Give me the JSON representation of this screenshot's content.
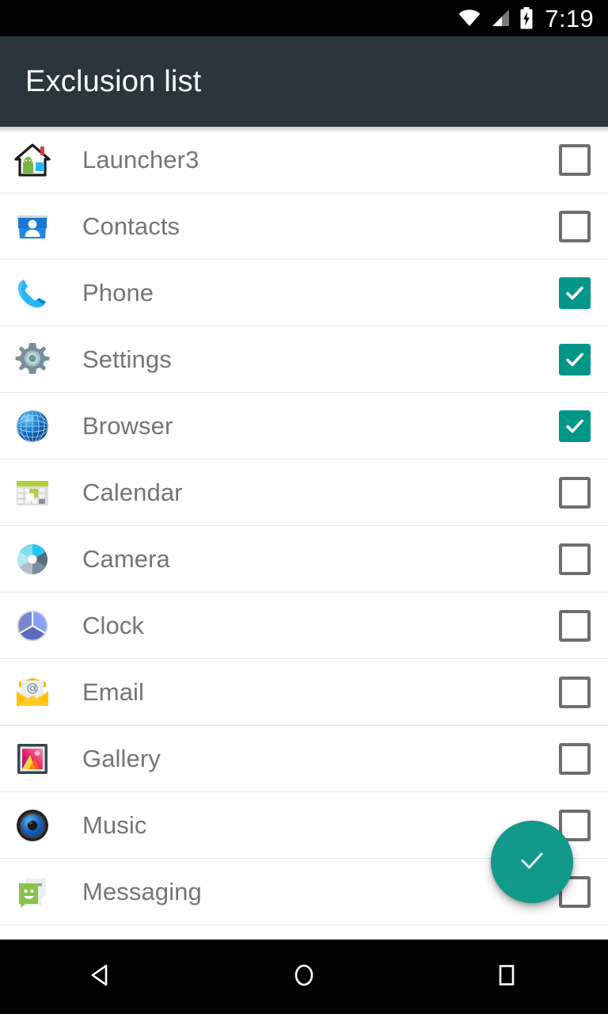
{
  "statusbar": {
    "time": "7:19",
    "icons": [
      "wifi-icon",
      "cellular-signal-icon",
      "battery-charging-icon"
    ]
  },
  "appbar": {
    "title": "Exclusion list",
    "background_color": "#2b353c",
    "title_color": "#ffffff"
  },
  "theme": {
    "accent_color": "#009688",
    "fab_color": "#11998a",
    "label_color": "#757575",
    "checkbox_off_border": "#6e6e6e",
    "divider_color": "#e6e6e6"
  },
  "list": {
    "items": [
      {
        "label": "Launcher3",
        "icon": "launcher-house-icon",
        "checked": false
      },
      {
        "label": "Contacts",
        "icon": "contacts-card-icon",
        "checked": false
      },
      {
        "label": "Phone",
        "icon": "phone-handset-icon",
        "checked": true
      },
      {
        "label": "Settings",
        "icon": "settings-gear-icon",
        "checked": true
      },
      {
        "label": "Browser",
        "icon": "browser-globe-icon",
        "checked": true
      },
      {
        "label": "Calendar",
        "icon": "calendar-grid-icon",
        "checked": false
      },
      {
        "label": "Camera",
        "icon": "camera-aperture-icon",
        "checked": false
      },
      {
        "label": "Clock",
        "icon": "clock-face-icon",
        "checked": false
      },
      {
        "label": "Email",
        "icon": "email-envelope-icon",
        "checked": false
      },
      {
        "label": "Gallery",
        "icon": "gallery-photo-icon",
        "checked": false
      },
      {
        "label": "Music",
        "icon": "music-speaker-icon",
        "checked": false
      },
      {
        "label": "Messaging",
        "icon": "messaging-bubble-icon",
        "checked": false
      }
    ]
  },
  "fab": {
    "icon": "check-icon",
    "label": "Confirm"
  },
  "navbar": {
    "buttons": [
      {
        "name": "back-button",
        "icon": "back-triangle-icon"
      },
      {
        "name": "home-button",
        "icon": "home-circle-icon"
      },
      {
        "name": "recents-button",
        "icon": "recents-square-icon"
      }
    ]
  }
}
